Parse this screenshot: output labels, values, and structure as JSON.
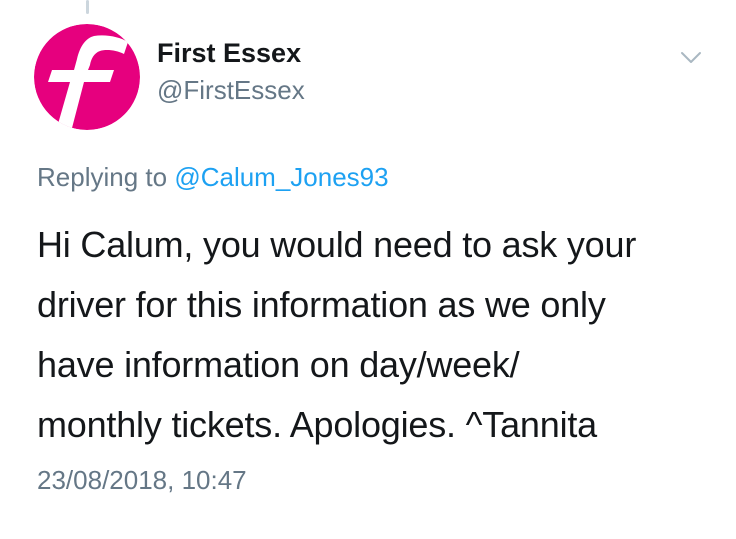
{
  "tweet": {
    "author": {
      "display_name": "First Essex",
      "handle": "@FirstEssex",
      "avatar_color": "#e6007e"
    },
    "replying_to": {
      "prefix": "Replying to",
      "mention": "@Calum_Jones93"
    },
    "body_lines": [
      "Hi Calum, you would need to ask your",
      "driver for this information as we only",
      "have information on day/week/",
      "monthly tickets. Apologies. ^Tannita"
    ],
    "timestamp": "23/08/2018, 10:47"
  },
  "colors": {
    "mention": "#1da1f2",
    "secondary_text": "#657786",
    "primary_text": "#14171a"
  },
  "icons": {
    "menu": "chevron-down-icon",
    "avatar_logo": "first-bus-logo"
  }
}
